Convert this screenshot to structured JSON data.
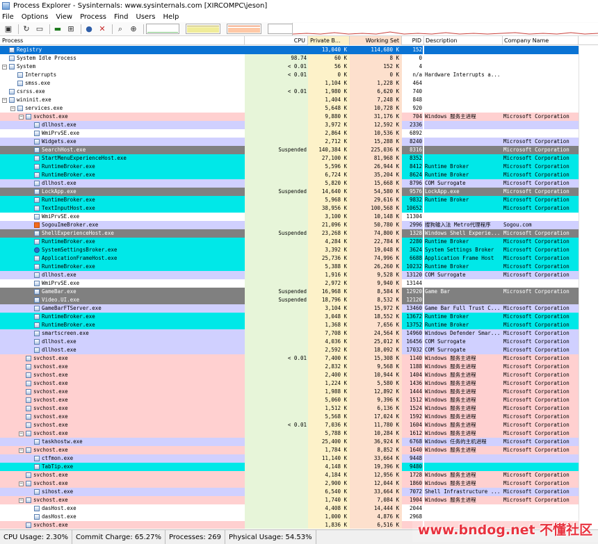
{
  "window": {
    "title": "Process Explorer - Sysinternals: www.sysinternals.com [XIRCOMPC\\jeson]"
  },
  "menu": [
    "File",
    "Options",
    "View",
    "Process",
    "Find",
    "Users",
    "Help"
  ],
  "toolbar": {
    "icons": [
      "save-icon",
      "refresh-icon",
      "system-info-icon",
      "process-tree-icon",
      "properties-icon",
      "find-icon",
      "kill-icon",
      "find-window-icon",
      "target-icon"
    ]
  },
  "columns": {
    "process": "Process",
    "cpu": "CPU",
    "private": "Private B...",
    "working": "Working Set",
    "pid": "PID",
    "description": "Description",
    "company": "Company Name"
  },
  "colors": {
    "services": "#ffd0d0",
    "own": "#d0d0ff",
    "immersive": "#00e8e8",
    "suspended": "#808080",
    "selected": "#0a73d4",
    "cpu_col": "#e7f5d9",
    "private_col": "#fdf2c9",
    "ws_col": "#fde0cd"
  },
  "processes": [
    {
      "name": "Registry",
      "cpu": "",
      "private": "13,040 K",
      "working": "114,680 K",
      "pid": "152",
      "desc": "",
      "company": "",
      "depth": 0,
      "bg": "selected"
    },
    {
      "name": "System Idle Process",
      "cpu": "98.74",
      "private": "60 K",
      "working": "8 K",
      "pid": "0",
      "desc": "",
      "company": "",
      "depth": 0,
      "bg": ""
    },
    {
      "name": "System",
      "cpu": "< 0.01",
      "private": "56 K",
      "working": "152 K",
      "pid": "4",
      "desc": "",
      "company": "",
      "depth": 0,
      "bg": "",
      "toggle": "-"
    },
    {
      "name": "Interrupts",
      "cpu": "< 0.01",
      "private": "0 K",
      "working": "0 K",
      "pid": "n/a",
      "desc": "Hardware Interrupts a...",
      "company": "",
      "depth": 1,
      "bg": ""
    },
    {
      "name": "smss.exe",
      "cpu": "",
      "private": "1,104 K",
      "working": "1,228 K",
      "pid": "464",
      "desc": "",
      "company": "",
      "depth": 1,
      "bg": ""
    },
    {
      "name": "csrss.exe",
      "cpu": "< 0.01",
      "private": "1,980 K",
      "working": "6,620 K",
      "pid": "740",
      "desc": "",
      "company": "",
      "depth": 0,
      "bg": ""
    },
    {
      "name": "wininit.exe",
      "cpu": "",
      "private": "1,404 K",
      "working": "7,248 K",
      "pid": "848",
      "desc": "",
      "company": "",
      "depth": 0,
      "bg": "",
      "toggle": "-"
    },
    {
      "name": "services.exe",
      "cpu": "",
      "private": "5,648 K",
      "working": "10,728 K",
      "pid": "920",
      "desc": "",
      "company": "",
      "depth": 1,
      "bg": "",
      "toggle": "-"
    },
    {
      "name": "svchost.exe",
      "cpu": "",
      "private": "9,880 K",
      "working": "31,176 K",
      "pid": "704",
      "desc": "Windows 服务主进程",
      "company": "Microsoft Corporation",
      "depth": 2,
      "bg": "services",
      "toggle": "-"
    },
    {
      "name": "dllhost.exe",
      "cpu": "",
      "private": "3,972 K",
      "working": "12,592 K",
      "pid": "2336",
      "desc": "",
      "company": "",
      "depth": 3,
      "bg": "own"
    },
    {
      "name": "WmiPrvSE.exe",
      "cpu": "",
      "private": "2,864 K",
      "working": "10,536 K",
      "pid": "6892",
      "desc": "",
      "company": "",
      "depth": 3,
      "bg": ""
    },
    {
      "name": "Widgets.exe",
      "cpu": "",
      "private": "2,712 K",
      "working": "15,288 K",
      "pid": "8240",
      "desc": "",
      "company": "Microsoft Corporation",
      "depth": 3,
      "bg": "own"
    },
    {
      "name": "SearchHost.exe",
      "cpu": "Suspended",
      "private": "140,384 K",
      "working": "225,036 K",
      "pid": "8316",
      "desc": "",
      "company": "Microsoft Corporation",
      "depth": 3,
      "bg": "suspended"
    },
    {
      "name": "StartMenuExperienceHost.exe",
      "cpu": "",
      "private": "27,100 K",
      "working": "81,968 K",
      "pid": "8352",
      "desc": "",
      "company": "Microsoft Corporation",
      "depth": 3,
      "bg": "immersive"
    },
    {
      "name": "RuntimeBroker.exe",
      "cpu": "",
      "private": "5,596 K",
      "working": "26,944 K",
      "pid": "8412",
      "desc": "Runtime Broker",
      "company": "Microsoft Corporation",
      "depth": 3,
      "bg": "immersive"
    },
    {
      "name": "RuntimeBroker.exe",
      "cpu": "",
      "private": "6,724 K",
      "working": "35,204 K",
      "pid": "8624",
      "desc": "Runtime Broker",
      "company": "Microsoft Corporation",
      "depth": 3,
      "bg": "immersive"
    },
    {
      "name": "dllhost.exe",
      "cpu": "",
      "private": "5,820 K",
      "working": "15,668 K",
      "pid": "8796",
      "desc": "COM Surrogate",
      "company": "Microsoft Corporation",
      "depth": 3,
      "bg": "own"
    },
    {
      "name": "LockApp.exe",
      "cpu": "Suspended",
      "private": "14,640 K",
      "working": "54,580 K",
      "pid": "9576",
      "desc": "LockApp.exe",
      "company": "Microsoft Corporation",
      "depth": 3,
      "bg": "suspended"
    },
    {
      "name": "RuntimeBroker.exe",
      "cpu": "",
      "private": "5,968 K",
      "working": "29,616 K",
      "pid": "9832",
      "desc": "Runtime Broker",
      "company": "Microsoft Corporation",
      "depth": 3,
      "bg": "immersive"
    },
    {
      "name": "TextInputHost.exe",
      "cpu": "",
      "private": "38,956 K",
      "working": "100,568 K",
      "pid": "10652",
      "desc": "",
      "company": "Microsoft Corporation",
      "depth": 3,
      "bg": "immersive"
    },
    {
      "name": "WmiPrvSE.exe",
      "cpu": "",
      "private": "3,100 K",
      "working": "10,148 K",
      "pid": "11304",
      "desc": "",
      "company": "",
      "depth": 3,
      "bg": ""
    },
    {
      "name": "SogouImeBroker.exe",
      "cpu": "",
      "private": "21,096 K",
      "working": "50,780 K",
      "pid": "2996",
      "desc": "搜狗输入法 Metro代理程序",
      "company": "Sogou.com",
      "depth": 3,
      "bg": "own",
      "icon": "sogou"
    },
    {
      "name": "ShellExperienceHost.exe",
      "cpu": "Suspended",
      "private": "23,268 K",
      "working": "74,800 K",
      "pid": "1328",
      "desc": "Windows Shell Experie...",
      "company": "Microsoft Corporation",
      "depth": 3,
      "bg": "suspended"
    },
    {
      "name": "RuntimeBroker.exe",
      "cpu": "",
      "private": "4,284 K",
      "working": "22,784 K",
      "pid": "2280",
      "desc": "Runtime Broker",
      "company": "Microsoft Corporation",
      "depth": 3,
      "bg": "immersive"
    },
    {
      "name": "SystemSettingsBroker.exe",
      "cpu": "",
      "private": "3,392 K",
      "working": "19,048 K",
      "pid": "3624",
      "desc": "System Settings Broker",
      "company": "Microsoft Corporation",
      "depth": 3,
      "bg": "immersive",
      "icon": "gear"
    },
    {
      "name": "ApplicationFrameHost.exe",
      "cpu": "",
      "private": "25,736 K",
      "working": "74,996 K",
      "pid": "6688",
      "desc": "Application Frame Host",
      "company": "Microsoft Corporation",
      "depth": 3,
      "bg": "immersive"
    },
    {
      "name": "RuntimeBroker.exe",
      "cpu": "",
      "private": "5,388 K",
      "working": "26,260 K",
      "pid": "10232",
      "desc": "Runtime Broker",
      "company": "Microsoft Corporation",
      "depth": 3,
      "bg": "immersive"
    },
    {
      "name": "dllhost.exe",
      "cpu": "",
      "private": "1,916 K",
      "working": "9,528 K",
      "pid": "13120",
      "desc": "COM Surrogate",
      "company": "Microsoft Corporation",
      "depth": 3,
      "bg": "own"
    },
    {
      "name": "WmiPrvSE.exe",
      "cpu": "",
      "private": "2,972 K",
      "working": "9,940 K",
      "pid": "13144",
      "desc": "",
      "company": "",
      "depth": 3,
      "bg": ""
    },
    {
      "name": "GameBar.exe",
      "cpu": "Suspended",
      "private": "16,968 K",
      "working": "8,584 K",
      "pid": "12920",
      "desc": "Game Bar",
      "company": "Microsoft Corporation",
      "depth": 3,
      "bg": "suspended"
    },
    {
      "name": "Video.UI.exe",
      "cpu": "Suspended",
      "private": "18,796 K",
      "working": "8,532 K",
      "pid": "12120",
      "desc": "",
      "company": "",
      "depth": 3,
      "bg": "suspended"
    },
    {
      "name": "GameBarFTServer.exe",
      "cpu": "",
      "private": "3,104 K",
      "working": "15,972 K",
      "pid": "13460",
      "desc": "Game Bar Full Trust C...",
      "company": "Microsoft Corporation",
      "depth": 3,
      "bg": "own"
    },
    {
      "name": "RuntimeBroker.exe",
      "cpu": "",
      "private": "3,048 K",
      "working": "18,552 K",
      "pid": "13672",
      "desc": "Runtime Broker",
      "company": "Microsoft Corporation",
      "depth": 3,
      "bg": "immersive"
    },
    {
      "name": "RuntimeBroker.exe",
      "cpu": "",
      "private": "1,368 K",
      "working": "7,656 K",
      "pid": "13752",
      "desc": "Runtime Broker",
      "company": "Microsoft Corporation",
      "depth": 3,
      "bg": "immersive"
    },
    {
      "name": "smartscreen.exe",
      "cpu": "",
      "private": "7,708 K",
      "working": "24,564 K",
      "pid": "14960",
      "desc": "Windows Defender Smar...",
      "company": "Microsoft Corporation",
      "depth": 3,
      "bg": "own"
    },
    {
      "name": "dllhost.exe",
      "cpu": "",
      "private": "4,036 K",
      "working": "25,012 K",
      "pid": "16456",
      "desc": "COM Surrogate",
      "company": "Microsoft Corporation",
      "depth": 3,
      "bg": "own"
    },
    {
      "name": "dllhost.exe",
      "cpu": "",
      "private": "2,592 K",
      "working": "18,092 K",
      "pid": "17032",
      "desc": "COM Surrogate",
      "company": "Microsoft Corporation",
      "depth": 3,
      "bg": "own"
    },
    {
      "name": "svchost.exe",
      "cpu": "< 0.01",
      "private": "7,400 K",
      "working": "15,308 K",
      "pid": "1140",
      "desc": "Windows 服务主进程",
      "company": "Microsoft Corporation",
      "depth": 2,
      "bg": "services"
    },
    {
      "name": "svchost.exe",
      "cpu": "",
      "private": "2,832 K",
      "working": "9,568 K",
      "pid": "1188",
      "desc": "Windows 服务主进程",
      "company": "Microsoft Corporation",
      "depth": 2,
      "bg": "services"
    },
    {
      "name": "svchost.exe",
      "cpu": "",
      "private": "2,400 K",
      "working": "10,944 K",
      "pid": "1404",
      "desc": "Windows 服务主进程",
      "company": "Microsoft Corporation",
      "depth": 2,
      "bg": "services"
    },
    {
      "name": "svchost.exe",
      "cpu": "",
      "private": "1,224 K",
      "working": "5,580 K",
      "pid": "1436",
      "desc": "Windows 服务主进程",
      "company": "Microsoft Corporation",
      "depth": 2,
      "bg": "services"
    },
    {
      "name": "svchost.exe",
      "cpu": "",
      "private": "1,988 K",
      "working": "12,892 K",
      "pid": "1444",
      "desc": "Windows 服务主进程",
      "company": "Microsoft Corporation",
      "depth": 2,
      "bg": "services"
    },
    {
      "name": "svchost.exe",
      "cpu": "",
      "private": "5,060 K",
      "working": "9,396 K",
      "pid": "1512",
      "desc": "Windows 服务主进程",
      "company": "Microsoft Corporation",
      "depth": 2,
      "bg": "services"
    },
    {
      "name": "svchost.exe",
      "cpu": "",
      "private": "1,512 K",
      "working": "6,136 K",
      "pid": "1524",
      "desc": "Windows 服务主进程",
      "company": "Microsoft Corporation",
      "depth": 2,
      "bg": "services"
    },
    {
      "name": "svchost.exe",
      "cpu": "",
      "private": "5,568 K",
      "working": "17,024 K",
      "pid": "1592",
      "desc": "Windows 服务主进程",
      "company": "Microsoft Corporation",
      "depth": 2,
      "bg": "services"
    },
    {
      "name": "svchost.exe",
      "cpu": "< 0.01",
      "private": "7,036 K",
      "working": "11,780 K",
      "pid": "1604",
      "desc": "Windows 服务主进程",
      "company": "Microsoft Corporation",
      "depth": 2,
      "bg": "services"
    },
    {
      "name": "svchost.exe",
      "cpu": "",
      "private": "5,788 K",
      "working": "10,284 K",
      "pid": "1612",
      "desc": "Windows 服务主进程",
      "company": "Microsoft Corporation",
      "depth": 2,
      "bg": "services",
      "toggle": "-"
    },
    {
      "name": "taskhostw.exe",
      "cpu": "",
      "private": "25,400 K",
      "working": "36,924 K",
      "pid": "6768",
      "desc": "Windows 任务的主机进程",
      "company": "Microsoft Corporation",
      "depth": 3,
      "bg": "own"
    },
    {
      "name": "svchost.exe",
      "cpu": "",
      "private": "1,784 K",
      "working": "8,852 K",
      "pid": "1640",
      "desc": "Windows 服务主进程",
      "company": "Microsoft Corporation",
      "depth": 2,
      "bg": "services",
      "toggle": "-"
    },
    {
      "name": "ctfmon.exe",
      "cpu": "",
      "private": "11,140 K",
      "working": "33,664 K",
      "pid": "9448",
      "desc": "",
      "company": "",
      "depth": 3,
      "bg": "own"
    },
    {
      "name": "TabTip.exe",
      "cpu": "",
      "private": "4,148 K",
      "working": "19,396 K",
      "pid": "9480",
      "desc": "",
      "company": "",
      "depth": 3,
      "bg": "immersive"
    },
    {
      "name": "svchost.exe",
      "cpu": "",
      "private": "4,184 K",
      "working": "12,956 K",
      "pid": "1728",
      "desc": "Windows 服务主进程",
      "company": "Microsoft Corporation",
      "depth": 2,
      "bg": "services"
    },
    {
      "name": "svchost.exe",
      "cpu": "",
      "private": "2,900 K",
      "working": "12,044 K",
      "pid": "1860",
      "desc": "Windows 服务主进程",
      "company": "Microsoft Corporation",
      "depth": 2,
      "bg": "services",
      "toggle": "-"
    },
    {
      "name": "sihost.exe",
      "cpu": "",
      "private": "6,540 K",
      "working": "33,664 K",
      "pid": "7072",
      "desc": "Shell Infrastructure ...",
      "company": "Microsoft Corporation",
      "depth": 3,
      "bg": "own"
    },
    {
      "name": "svchost.exe",
      "cpu": "",
      "private": "1,740 K",
      "working": "7,084 K",
      "pid": "1904",
      "desc": "Windows 服务主进程",
      "company": "Microsoft Corporation",
      "depth": 2,
      "bg": "services",
      "toggle": "-"
    },
    {
      "name": "dasHost.exe",
      "cpu": "",
      "private": "4,408 K",
      "working": "14,444 K",
      "pid": "2044",
      "desc": "",
      "company": "",
      "depth": 3,
      "bg": ""
    },
    {
      "name": "dasHost.exe",
      "cpu": "",
      "private": "1,000 K",
      "working": "4,876 K",
      "pid": "2968",
      "desc": "",
      "company": "",
      "depth": 3,
      "bg": ""
    },
    {
      "name": "svchost.exe",
      "cpu": "",
      "private": "1,836 K",
      "working": "6,516 K",
      "pid": "",
      "desc": "",
      "company": "",
      "depth": 2,
      "bg": "services"
    }
  ],
  "status": {
    "cpu": "CPU Usage: 2.30%",
    "commit": "Commit Charge: 65.27%",
    "processes": "Processes: 269",
    "physical": "Physical Usage: 54.53%"
  },
  "gauges": {
    "cpu_fraction": 0.02,
    "commit_fraction": 0.65,
    "physical_fraction": 0.55
  },
  "watermark": "www.bndog.net 不懂社区"
}
